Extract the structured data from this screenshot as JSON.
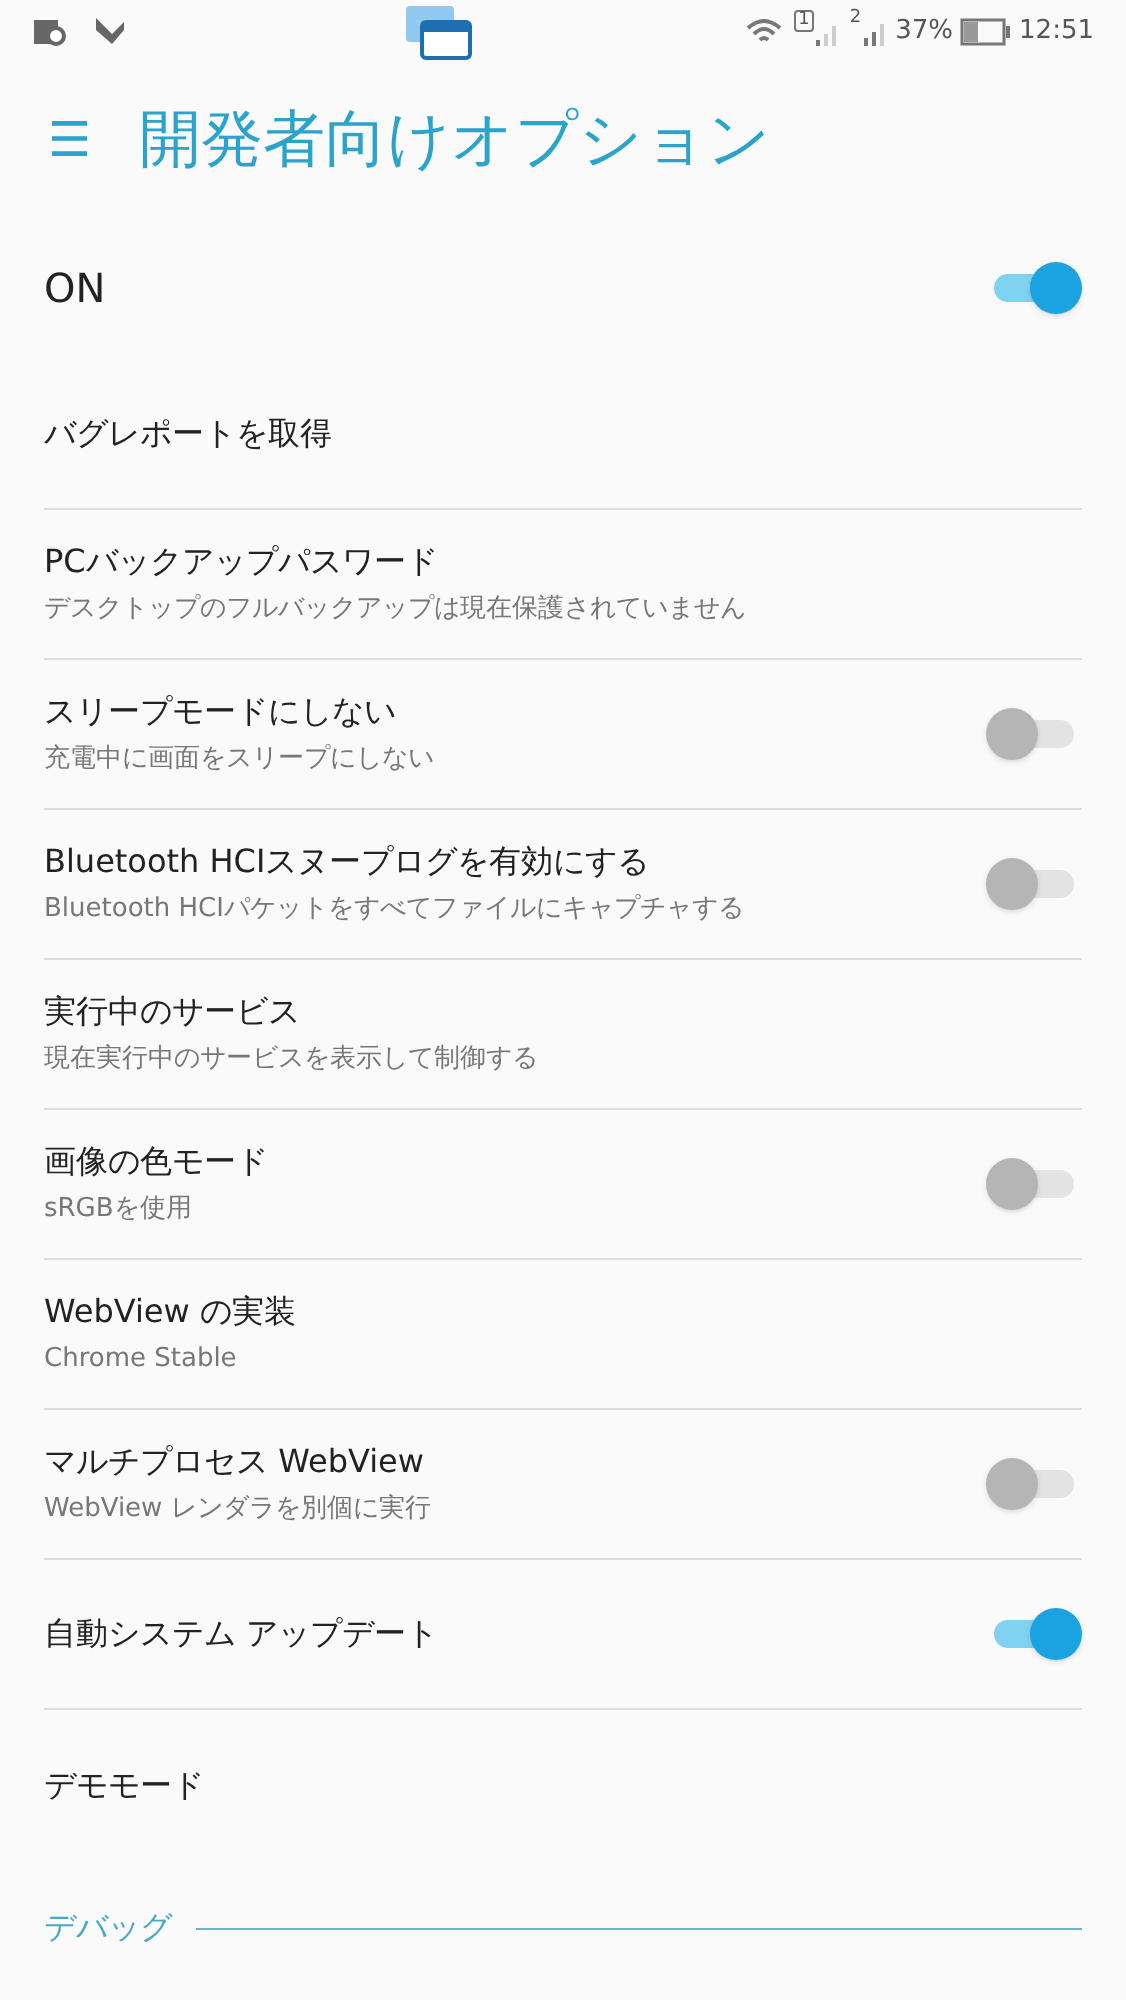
{
  "status_bar": {
    "sim_1": "1",
    "sim_2": "2",
    "battery": "37%",
    "time": "12:51"
  },
  "app_bar": {
    "menu_glyph": "☰",
    "title": "開発者向けオプション"
  },
  "master": {
    "label": "ON",
    "on": true
  },
  "items": [
    {
      "kind": "plain",
      "title": "バグレポートを取得"
    },
    {
      "kind": "plain",
      "title": "PCバックアップパスワード",
      "summary": "デスクトップのフルバックアップは現在保護されていません"
    },
    {
      "kind": "switch",
      "title": "スリープモードにしない",
      "summary": "充電中に画面をスリープにしない",
      "on": false
    },
    {
      "kind": "switch",
      "title": "Bluetooth HCIスヌープログを有効にする",
      "summary": "Bluetooth HCIパケットをすべてファイルにキャプチャする",
      "on": false
    },
    {
      "kind": "plain",
      "title": "実行中のサービス",
      "summary": "現在実行中のサービスを表示して制御する"
    },
    {
      "kind": "switch",
      "title": "画像の色モード",
      "summary": "sRGBを使用",
      "on": false
    },
    {
      "kind": "plain",
      "title": "WebView の実装",
      "summary": "Chrome Stable"
    },
    {
      "kind": "switch",
      "title": "マルチプロセス WebView",
      "summary": "WebView レンダラを別個に実行",
      "on": false
    },
    {
      "kind": "switch",
      "title": "自動システム アップデート",
      "on": true
    },
    {
      "kind": "plain",
      "title": "デモモード"
    }
  ],
  "section": {
    "title": "デバッグ"
  }
}
